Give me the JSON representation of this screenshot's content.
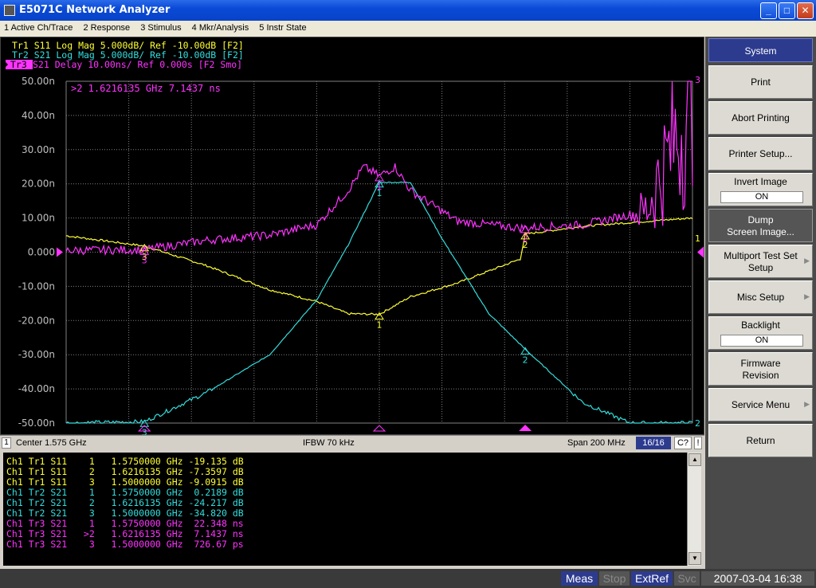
{
  "window": {
    "title": "E5071C Network Analyzer",
    "min_glyph": "_",
    "max_glyph": "□",
    "close_glyph": "✕"
  },
  "menu": [
    "1 Active Ch/Trace",
    "2 Response",
    "3 Stimulus",
    "4 Mkr/Analysis",
    "5 Instr State"
  ],
  "traces": {
    "tr1": "Tr1  S11 Log Mag 5.000dB/ Ref -10.00dB [F2]",
    "tr2": "Tr2  S21 Log Mag 5.000dB/ Ref -10.00dB [F2]",
    "tr3_tag": "Tr3",
    "tr3": " S21 Delay 10.00ns/ Ref 0.000s [F2 Smo]"
  },
  "active_marker": ">2  1.6216135 GHz  7.1437 ns",
  "y_ticks": [
    "50.00n",
    "40.00n",
    "30.00n",
    "20.00n",
    "10.00n",
    "0.000",
    "-10.00n",
    "-20.00n",
    "-30.00n",
    "-40.00n",
    "-50.00n"
  ],
  "right_edge_labels": [
    "3",
    "1",
    "2"
  ],
  "markers": {
    "tr1": [
      "1",
      "2",
      "3"
    ],
    "tr2": [
      "1",
      "2",
      "3"
    ],
    "tr3": [
      "1",
      "2",
      "3"
    ]
  },
  "colors": {
    "tr1": "#ffff33",
    "tr2": "#33dddd",
    "tr3": "#ff33ff",
    "grid": "#808080",
    "axis_text": "#c0c0c0"
  },
  "chart_data": {
    "type": "line",
    "x_range_ghz": [
      1.475,
      1.675
    ],
    "grid": true,
    "series": [
      {
        "name": "Tr1 S11 Log Mag",
        "unit": "dB",
        "ref": -10.0,
        "per_div": 5.0,
        "x": [
          1.475,
          1.5,
          1.52,
          1.54,
          1.555,
          1.565,
          1.575,
          1.585,
          1.6,
          1.62,
          1.6216,
          1.64,
          1.66,
          1.675
        ],
        "y": [
          -7.6,
          -9.1,
          -12.0,
          -15.5,
          -17.2,
          -19.0,
          -19.1,
          -16.5,
          -14.5,
          -11.0,
          -7.36,
          -6.2,
          -5.5,
          -5.0
        ]
      },
      {
        "name": "Tr2 S21 Log Mag",
        "unit": "dB",
        "ref": -10.0,
        "per_div": 5.0,
        "x": [
          1.475,
          1.5,
          1.52,
          1.54,
          1.555,
          1.565,
          1.575,
          1.585,
          1.595,
          1.61,
          1.6216,
          1.64,
          1.655,
          1.675
        ],
        "y": [
          -35.0,
          -34.8,
          -30.5,
          -25.0,
          -17.0,
          -9.0,
          0.22,
          0.2,
          -8.0,
          -19.0,
          -24.2,
          -32.0,
          -35.0,
          -35.0
        ]
      },
      {
        "name": "Tr3 S21 Delay",
        "unit": "ns",
        "ref": 0.0,
        "per_div": 10.0,
        "x": [
          1.475,
          1.5,
          1.52,
          1.54,
          1.555,
          1.565,
          1.57,
          1.575,
          1.58,
          1.585,
          1.6,
          1.62,
          1.6216,
          1.64,
          1.66,
          1.675
        ],
        "y": [
          0.5,
          0.73,
          3.5,
          5.0,
          8.0,
          18.0,
          25.0,
          22.3,
          25.0,
          18.0,
          9.0,
          7.1,
          7.14,
          8.0,
          12.0,
          45.0
        ]
      }
    ]
  },
  "status": {
    "channel": "1",
    "center": "Center 1.575 GHz",
    "ifbw": "IFBW 70 kHz",
    "span": "Span 200 MHz",
    "sweeps": "16/16",
    "cq": "C?",
    "bang": "!"
  },
  "marker_rows": [
    {
      "ch": "Ch1",
      "tr": "Tr1",
      "param": "S11",
      "num": "1",
      "freq": "1.5750000 GHz",
      "val": "-19.135",
      "unit": "dB"
    },
    {
      "ch": "Ch1",
      "tr": "Tr1",
      "param": "S11",
      "num": "2",
      "freq": "1.6216135 GHz",
      "val": "-7.3597",
      "unit": "dB"
    },
    {
      "ch": "Ch1",
      "tr": "Tr1",
      "param": "S11",
      "num": "3",
      "freq": "1.5000000 GHz",
      "val": "-9.0915",
      "unit": "dB"
    },
    {
      "ch": "Ch1",
      "tr": "Tr2",
      "param": "S21",
      "num": "1",
      "freq": "1.5750000 GHz",
      "val": "0.2189",
      "unit": "dB"
    },
    {
      "ch": "Ch1",
      "tr": "Tr2",
      "param": "S21",
      "num": "2",
      "freq": "1.6216135 GHz",
      "val": "-24.217",
      "unit": "dB"
    },
    {
      "ch": "Ch1",
      "tr": "Tr2",
      "param": "S21",
      "num": "3",
      "freq": "1.5000000 GHz",
      "val": "-34.820",
      "unit": "dB"
    },
    {
      "ch": "Ch1",
      "tr": "Tr3",
      "param": "S21",
      "num": "1",
      "freq": "1.5750000 GHz",
      "val": "22.348",
      "unit": "ns"
    },
    {
      "ch": "Ch1",
      "tr": "Tr3",
      "param": "S21",
      "num": ">2",
      "freq": "1.6216135 GHz",
      "val": "7.1437",
      "unit": "ns"
    },
    {
      "ch": "Ch1",
      "tr": "Tr3",
      "param": "S21",
      "num": "3",
      "freq": "1.5000000 GHz",
      "val": "726.67",
      "unit": "ps"
    }
  ],
  "softkeys": {
    "system": "System",
    "print": "Print",
    "abort": "Abort Printing",
    "printer_setup": "Printer Setup...",
    "invert_label": "Invert Image",
    "invert_value": "ON",
    "dump_1": "Dump",
    "dump_2": "Screen Image...",
    "multiport_1": "Multiport Test Set",
    "multiport_2": "Setup",
    "misc": "Misc Setup",
    "backlight_label": "Backlight",
    "backlight_value": "ON",
    "firmware_1": "Firmware",
    "firmware_2": "Revision",
    "service": "Service Menu",
    "return": "Return"
  },
  "bottombar": {
    "meas": "Meas",
    "stop": "Stop",
    "extref": "ExtRef",
    "svc": "Svc",
    "datetime": "2007-03-04 16:38"
  }
}
